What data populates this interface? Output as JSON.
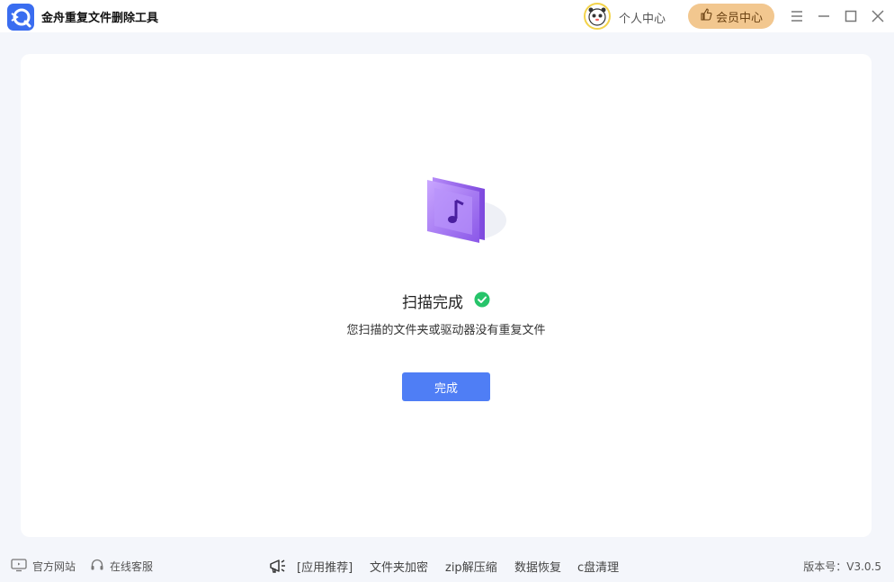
{
  "app": {
    "title": "金舟重复文件删除工具"
  },
  "header": {
    "user_center": "个人中心",
    "vip_center": "会员中心"
  },
  "main": {
    "status_title": "扫描完成",
    "description": "您扫描的文件夹或驱动器没有重复文件",
    "done_button": "完成"
  },
  "footer": {
    "website": "官方网站",
    "support": "在线客服",
    "recommend": "[应用推荐]",
    "links": [
      "文件夹加密",
      "zip解压缩",
      "数据恢复",
      "c盘清理"
    ],
    "version": "版本号：V3.0.5"
  },
  "colors": {
    "accent": "#4f7ef5",
    "vip": "#f2c78f",
    "success": "#27c46a",
    "illustration": "#a77bf0"
  }
}
